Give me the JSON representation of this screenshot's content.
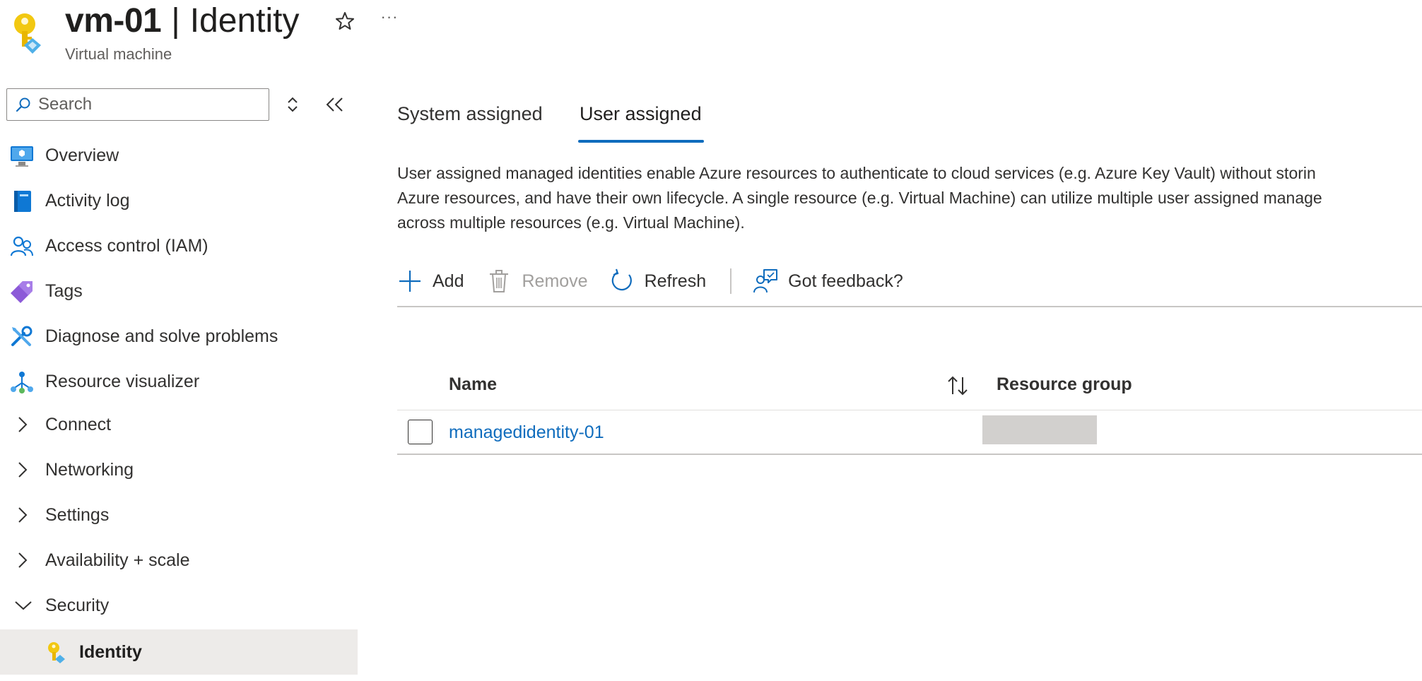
{
  "header": {
    "resource_name": "vm-01",
    "separator": "|",
    "blade_title": "Identity",
    "resource_type": "Virtual machine",
    "icon": "key-identity-icon",
    "star_icon": "star-icon",
    "more_icon": "ellipsis-icon",
    "more_label": "···"
  },
  "sidebar": {
    "search": {
      "placeholder": "Search",
      "value": ""
    },
    "items": [
      {
        "label": "Overview",
        "icon": "monitor-icon"
      },
      {
        "label": "Activity log",
        "icon": "log-book-icon"
      },
      {
        "label": "Access control (IAM)",
        "icon": "people-icon"
      },
      {
        "label": "Tags",
        "icon": "tag-icon"
      },
      {
        "label": "Diagnose and solve problems",
        "icon": "wrench-icon"
      },
      {
        "label": "Resource visualizer",
        "icon": "hierarchy-icon"
      },
      {
        "label": "Connect",
        "icon": "chevron-right-icon",
        "expanded": false
      },
      {
        "label": "Networking",
        "icon": "chevron-right-icon",
        "expanded": false
      },
      {
        "label": "Settings",
        "icon": "chevron-right-icon",
        "expanded": false
      },
      {
        "label": "Availability + scale",
        "icon": "chevron-right-icon",
        "expanded": false
      },
      {
        "label": "Security",
        "icon": "chevron-down-icon",
        "expanded": true
      },
      {
        "label": "Identity",
        "icon": "key-identity-icon",
        "active": true
      }
    ]
  },
  "main": {
    "tabs": [
      {
        "label": "System assigned",
        "selected": false
      },
      {
        "label": "User assigned",
        "selected": true
      }
    ],
    "description": [
      "User assigned managed identities enable Azure resources to authenticate to cloud services (e.g. Azure Key Vault) without storin",
      "Azure resources, and have their own lifecycle. A single resource (e.g. Virtual Machine) can utilize multiple user assigned manage",
      "across multiple resources (e.g. Virtual Machine)."
    ],
    "toolbar": {
      "add": "Add",
      "remove": "Remove",
      "refresh": "Refresh",
      "feedback": "Got feedback?"
    },
    "table": {
      "columns": [
        "Name",
        "Resource group"
      ],
      "rows": [
        {
          "name": "managedidentity-01",
          "resource_group": ""
        }
      ]
    }
  },
  "colors": {
    "accent": "#0f6cbd",
    "active_nav_bg": "#edebe9",
    "text": "#323130",
    "disabled": "#a19f9d",
    "redacted": "#d2d0ce"
  }
}
